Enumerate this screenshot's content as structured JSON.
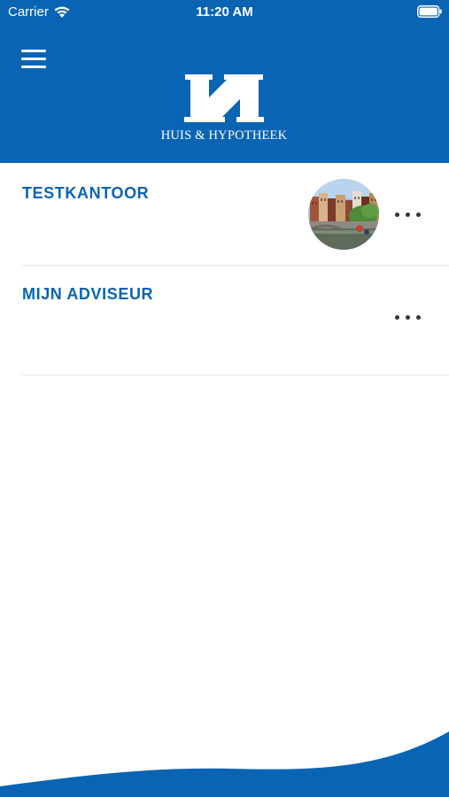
{
  "status_bar": {
    "carrier": "Carrier",
    "time": "11:20 AM"
  },
  "header": {
    "logo_text": "HUIS & HYPOTHEEK",
    "menu_icon": "hamburger-menu-icon"
  },
  "list": {
    "items": [
      {
        "title": "TESTKANTOOR",
        "has_photo": true,
        "more_icon": "more-horizontal-icon"
      },
      {
        "title": "MIJN ADVISEUR",
        "has_photo": false,
        "more_icon": "more-horizontal-icon"
      }
    ]
  },
  "colors": {
    "brand_blue": "#0a64b4",
    "divider": "#e4e8ec",
    "more_dots": "#333333",
    "background": "#ffffff"
  }
}
